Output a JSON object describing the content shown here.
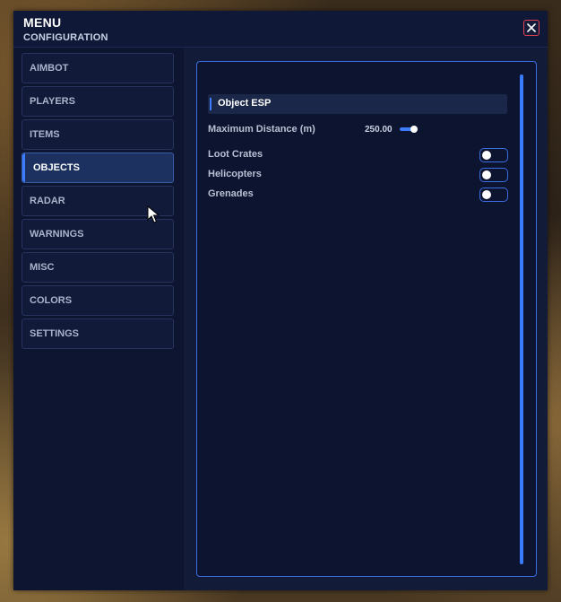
{
  "window": {
    "title": "MENU",
    "subtitle": "CONFIGURATION",
    "close_icon": "close-icon"
  },
  "sidebar": {
    "active": "OBJECTS",
    "items": [
      {
        "label": "AIMBOT"
      },
      {
        "label": "PLAYERS"
      },
      {
        "label": "ITEMS"
      },
      {
        "label": "OBJECTS"
      },
      {
        "label": "RADAR"
      },
      {
        "label": "WARNINGS"
      },
      {
        "label": "MISC"
      },
      {
        "label": "COLORS"
      },
      {
        "label": "SETTINGS"
      }
    ]
  },
  "panel": {
    "section_title": "Object ESP",
    "max_distance": {
      "label": "Maximum Distance (m)",
      "value": "250.00"
    },
    "toggles": [
      {
        "label": "Loot Crates",
        "on": false
      },
      {
        "label": "Helicopters",
        "on": false
      },
      {
        "label": "Grenades",
        "on": false
      }
    ]
  },
  "colors": {
    "accent": "#3d7bff",
    "background": "#0d1530",
    "close_border": "#e04050"
  }
}
